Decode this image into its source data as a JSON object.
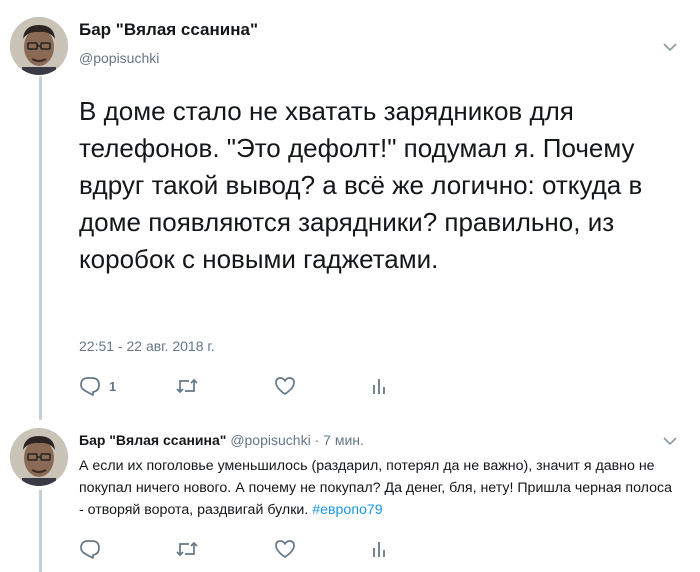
{
  "main_tweet": {
    "author_name": "Бар \"Вялая ссанина\"",
    "handle": "@popisuchki",
    "text": "В доме стало не хватать зарядников для телефонов. \"Это дефолт!\" подумал я. Почему вдруг такой вывод? а всё же логично: откуда в доме появляются зарядники? правильно, из коробок с новыми гаджетами.",
    "timestamp": "22:51 - 22 авг. 2018 г.",
    "reply_count": "1",
    "icons": {
      "reply": "reply-icon",
      "retweet": "retweet-icon",
      "like": "like-icon",
      "analytics": "analytics-icon",
      "menu": "chevron-down-icon"
    }
  },
  "reply_tweet": {
    "author_name": "Бар \"Вялая ссанина\"",
    "handle": "@popisuchki",
    "separator": "·",
    "time": "7 мин.",
    "text": "А если их поголовье уменьшилось (раздарил, потерял да не важно), значит я давно не покупал ничего нового. А почему не покупал? Да денег, бля, нету! Пришла черная полоса - отворяй ворота, раздвигай булки.",
    "hashtag": "#европо79"
  },
  "colors": {
    "text": "#14171a",
    "secondary": "#657786",
    "link": "#1b95e0",
    "thread_line": "#c4cfd6"
  }
}
